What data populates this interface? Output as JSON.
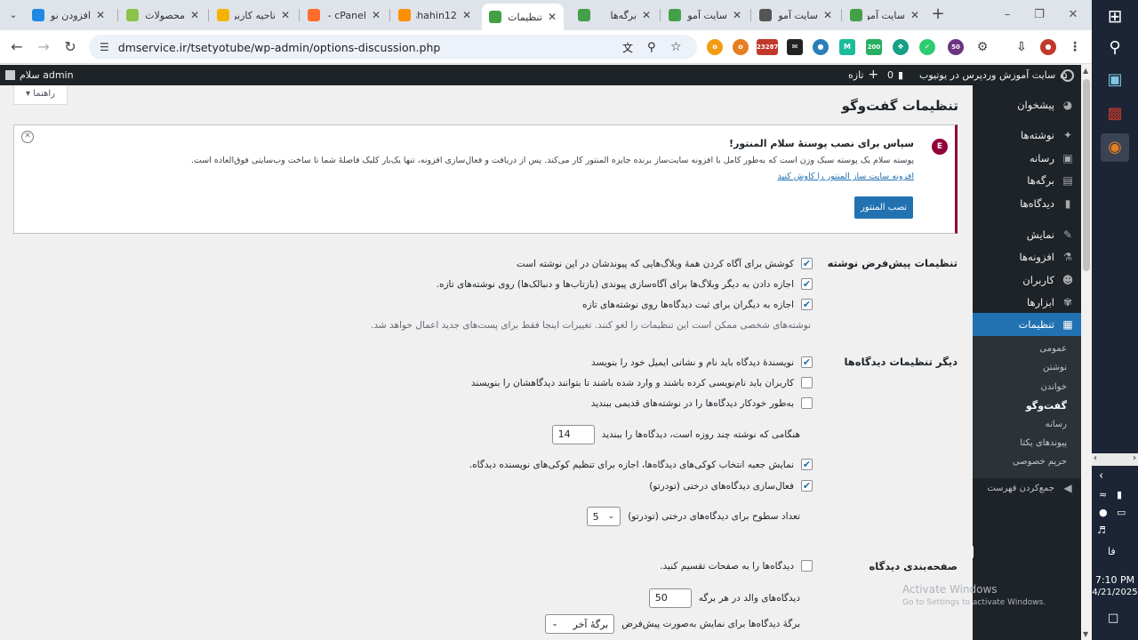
{
  "browser": {
    "tabs": [
      {
        "title": "افزودن نو",
        "favicon": "wp-icon",
        "color": "#1e88e5"
      },
      {
        "title": "محصولات",
        "favicon": "rank-math-icon",
        "color": "#8bc34a"
      },
      {
        "title": "ناحیه کاربر",
        "favicon": "crown-icon",
        "color": "#f5b301"
      },
      {
        "title": "cPanel -",
        "favicon": "cpanel-icon",
        "color": "#ff6c2c"
      },
      {
        "title": "shahin12",
        "favicon": "hosting-icon",
        "color": "#ff8f00"
      },
      {
        "title": "تنظیمات",
        "favicon": "g1-icon",
        "color": "#43a047",
        "active": true
      },
      {
        "title": "برگه‌ها",
        "favicon": "g1-icon",
        "color": "#43a047"
      },
      {
        "title": "سایت آمو",
        "favicon": "g1-icon",
        "color": "#43a047"
      },
      {
        "title": "سایت آمو",
        "favicon": "globe-icon",
        "color": "#555555"
      },
      {
        "title": "سایت آمو",
        "favicon": "g1-icon",
        "color": "#43a047"
      }
    ],
    "url": "dmservice.ir/tsetyotube/wp-admin/options-discussion.php",
    "ext_badge_1": "23287",
    "ext_badge_2": "200",
    "ext_badge_3": "50"
  },
  "adminbar": {
    "greeting": "سلام admin",
    "site_name": "سایت آموزش وردپرس در یوتیوب",
    "comments_count": "0",
    "new_label": "تازه"
  },
  "sidebar": {
    "items": [
      {
        "label": "پیشخوان",
        "icon": "dashboard-icon"
      },
      {
        "label": "نوشته‌ها",
        "icon": "pin-icon"
      },
      {
        "label": "رسانه",
        "icon": "media-icon"
      },
      {
        "label": "برگه‌ها",
        "icon": "page-icon"
      },
      {
        "label": "دیدگاه‌ها",
        "icon": "comment-icon"
      },
      {
        "label": "نمایش",
        "icon": "brush-icon"
      },
      {
        "label": "افزونه‌ها",
        "icon": "plugin-icon"
      },
      {
        "label": "کاربران",
        "icon": "user-icon"
      },
      {
        "label": "ابزارها",
        "icon": "wrench-icon"
      },
      {
        "label": "تنظیمات",
        "icon": "settings-icon"
      }
    ],
    "submenu": [
      "عمومی",
      "نوشتن",
      "خواندن",
      "گفت‌وگو",
      "رسانه",
      "پیوندهای یکتا",
      "حریم خصوصی"
    ],
    "collapse": "جمع‌کردن فهرست"
  },
  "main": {
    "help": "راهنما",
    "title": "تنظیمات گفت‌وگو",
    "notice": {
      "title": "سپاس برای نصب پوستهٔ سلام المنتور!",
      "body": "پوسته سلام یک پوسته سبک وزن است که به‌طور کامل با افزونه سایت‌ساز برنده جایزه المنتور کار می‌کند. پس از دریافت و فعال‌سازی افزونه، تنها یک‌بار کلیک فاصلهٔ شما تا ساخت وب‌سایتی فوق‌العاده است.",
      "link": "افزونه سایت ساز المنتور را کاوش کنید",
      "button": "نصب المنتور"
    },
    "default_post": {
      "title": "تنظیمات پیش‌فرض نوشته",
      "options": [
        {
          "label": "کوشش برای آگاه کردن همهٔ وبلاگ‌هایی که پیوندشان در این نوشته است",
          "checked": true
        },
        {
          "label": "اجازه دادن به دیگر وبلاگ‌ها برای آگاه‌سازی پیوندی (بازتاب‌ها و دنبالک‌ها) روی نوشته‌های تازه.",
          "checked": true
        },
        {
          "label": "اجازه به دیگران برای ثبت دیدگاه‌ها روی نوشته‌های تازه",
          "checked": true
        }
      ],
      "note": "نوشته‌های شخصی ممکن است این تنظیمات را لغو کنند. تغییرات اینجا فقط برای پست‌های جدید اعمال خواهد شد."
    },
    "other_comments": {
      "title": "دیگر تنظیمات دیدگاه‌ها",
      "options": [
        {
          "label": "نویسندهٔ دیدگاه باید نام و نشانی ایمیل خود را بنویسد",
          "checked": true
        },
        {
          "label": "کاربران باید نام‌نویسی کرده باشند و وارد شده باشند تا بتوانند دیدگاهشان را بنویسند",
          "checked": false
        },
        {
          "label": "به‌طور خودکار دیدگاه‌ها را در نوشته‌های قدیمی ببندید",
          "checked": false
        }
      ],
      "close_days_before": "هنگامی که نوشته چند روزه است، دیدگاه‌ها را ببندید",
      "close_days_value": "14",
      "options2": [
        {
          "label": "نمایش جعبه انتخاب کوکی‌های دیدگاه‌ها، اجازه برای تنظیم کوکی‌های نویسنده دیدگاه.",
          "checked": true
        },
        {
          "label": "فعال‌سازی دیدگاه‌های درختی (تودرتو)",
          "checked": true
        }
      ],
      "thread_depth_label": "تعداد سطوح برای دیدگاه‌های درختی (تودرتو)",
      "thread_depth_value": "5"
    },
    "pagination": {
      "title": "صفحه‌بندی دیدگاه",
      "paginate_label": "دیدگاه‌ها را به صفحات تقسیم کنید.",
      "paginate_checked": false,
      "per_page_label": "دیدگاه‌های والد در هر برگه",
      "per_page_value": "50",
      "default_page_label": "برگهٔ دیدگاه‌ها برای نمایش به‌صورت پیش‌فرض",
      "default_page_value": "برگهٔ آخر"
    }
  },
  "watermark": {
    "line1": "Activate Windows",
    "line2": "Go to Settings to activate Windows."
  },
  "taskbar": {
    "time": "7:10 PM",
    "date": "4/21/2025",
    "lang": "فا"
  }
}
